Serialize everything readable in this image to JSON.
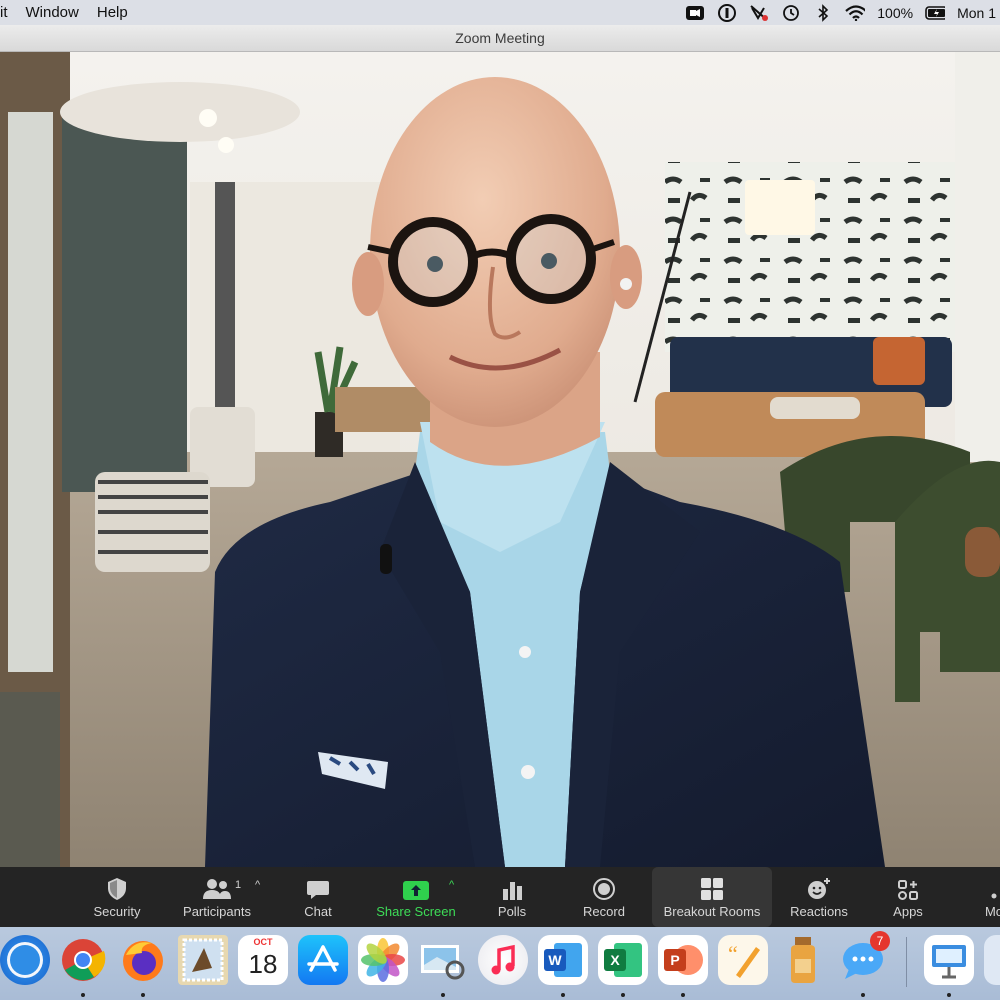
{
  "menubar": {
    "items": [
      "it",
      "Window",
      "Help"
    ],
    "battery": "100%",
    "clock": "Mon 1"
  },
  "window": {
    "title": "Zoom Meeting"
  },
  "toolbar": {
    "security": "Security",
    "participants": "Participants",
    "participant_count": "1",
    "chat": "Chat",
    "share_screen": "Share Screen",
    "polls": "Polls",
    "record": "Record",
    "breakout_rooms": "Breakout Rooms",
    "reactions": "Reactions",
    "apps": "Apps",
    "more": "Mo"
  },
  "dock": {
    "calendar_month": "OCT",
    "calendar_day": "18",
    "messages_badge": "7",
    "apps": [
      "Safari",
      "Chrome",
      "Firefox",
      "Mail",
      "Calendar",
      "App Store",
      "Photos",
      "Preview",
      "Music",
      "Word",
      "Excel",
      "PowerPoint",
      "Pages",
      "Growl",
      "Messages",
      "Keynote",
      "Finder"
    ]
  },
  "colors": {
    "toolbar_bg": "#242424",
    "share_green": "#3ddc57",
    "menubar_bg": "#dcdfe6"
  }
}
